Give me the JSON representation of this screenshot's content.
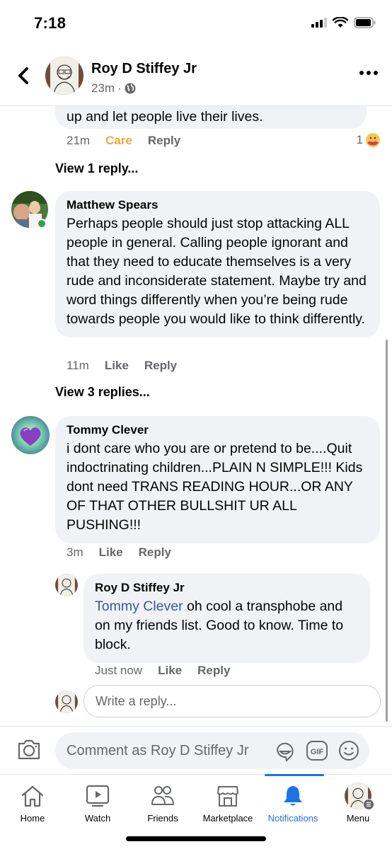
{
  "status_bar": {
    "time": "7:18"
  },
  "header": {
    "author": "Roy D Stiffey Jr",
    "timestamp": "23m",
    "separator": "·",
    "privacy_icon": "globe-icon"
  },
  "comments": [
    {
      "id": "c0",
      "author": "",
      "text_tail": "up and let people live their lives.",
      "time": "21m",
      "reaction_label": "Care",
      "reaction_color": "#e8a93c",
      "reply_label": "Reply",
      "reaction_count": "1",
      "reaction_icon": "care-emoji-icon",
      "view_replies": "View 1 reply..."
    },
    {
      "id": "c1",
      "author": "Matthew Spears",
      "online": true,
      "text": "Perhaps people should just stop attacking ALL people in general. Calling people ignorant and that they need to educate themselves is a very rude and inconsiderate statement. Maybe try and word things differently when you’re being rude towards people you would like to think differently.",
      "time": "11m",
      "like_label": "Like",
      "reply_label": "Reply",
      "view_replies": "View 3 replies..."
    },
    {
      "id": "c2",
      "author": "Tommy Clever",
      "text": "i dont care who you are or pretend to be....Quit indoctrinating children...PLAIN N SIMPLE!!! Kids dont need TRANS READING HOUR...OR ANY OF THAT OTHER BULLSHIT UR ALL PUSHING!!!",
      "time": "3m",
      "like_label": "Like",
      "reply_label": "Reply",
      "replies": [
        {
          "author": "Roy D Stiffey Jr",
          "mention": "Tommy Clever",
          "text": " oh cool a transphobe and on my friends list. Good to know. Time to block.",
          "time": "Just now",
          "like_label": "Like",
          "reply_label": "Reply"
        }
      ],
      "reply_input_placeholder": "Write a reply..."
    }
  ],
  "composer": {
    "placeholder": "Comment as Roy D Stiffey Jr",
    "icons": [
      "camera-icon",
      "sticker-icon",
      "gif-icon",
      "emoji-icon"
    ],
    "gif_label": "GIF"
  },
  "tabbar": {
    "active": "Notifications",
    "accent": "#1b74e4",
    "tabs": [
      {
        "label": "Home",
        "icon": "home-icon"
      },
      {
        "label": "Watch",
        "icon": "watch-icon"
      },
      {
        "label": "Friends",
        "icon": "friends-icon"
      },
      {
        "label": "Marketplace",
        "icon": "marketplace-icon"
      },
      {
        "label": "Notifications",
        "icon": "bell-icon"
      },
      {
        "label": "Menu",
        "icon": "menu-avatar-icon"
      }
    ]
  }
}
